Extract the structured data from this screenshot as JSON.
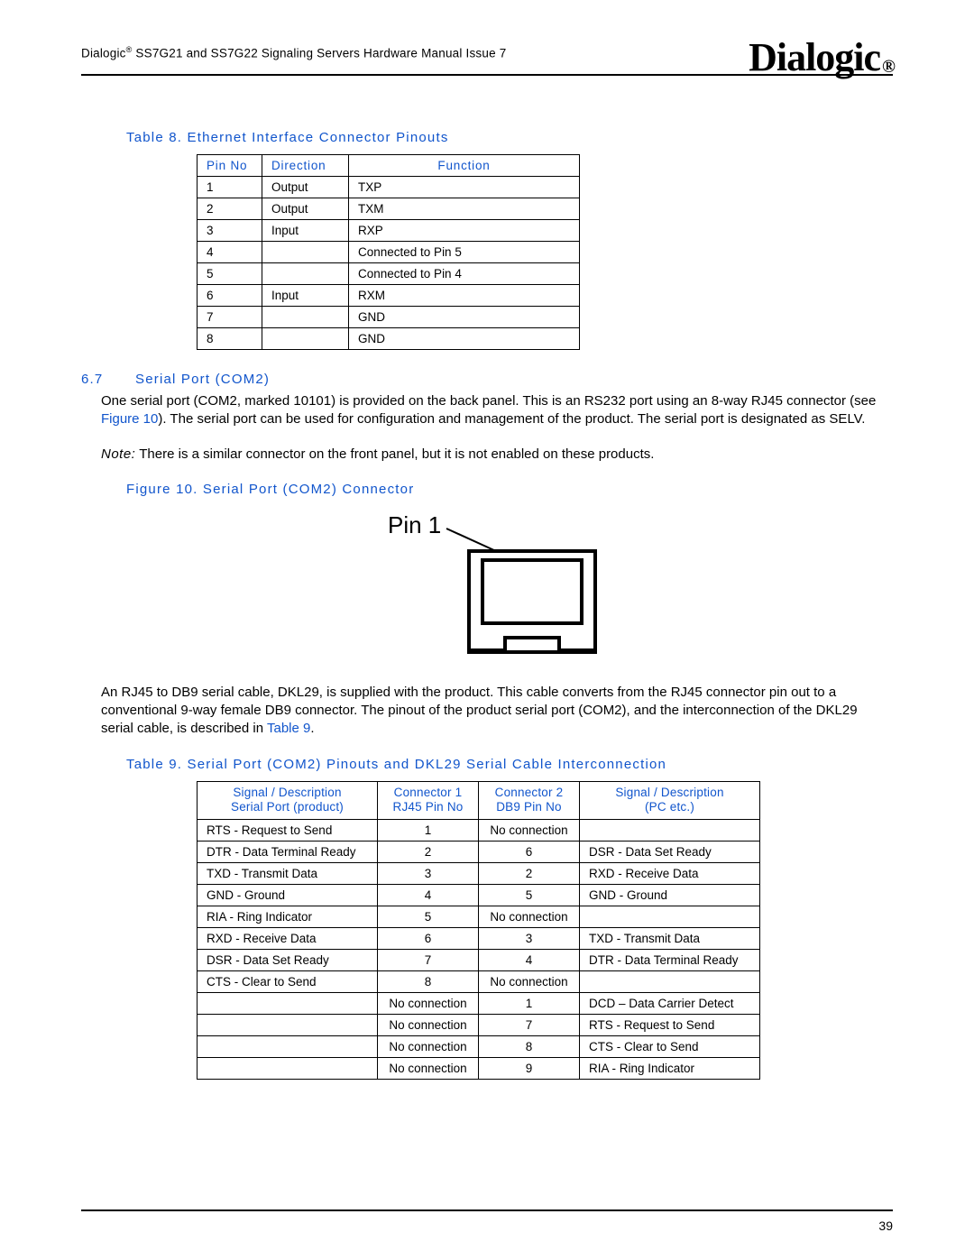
{
  "header": {
    "doc_title_left": "Dialogic",
    "doc_title_rest": " SS7G21 and SS7G22 Signaling Servers Hardware Manual  Issue 7",
    "logo_text": "Dialogic",
    "logo_reg": "®"
  },
  "table8": {
    "caption": "Table 8.  Ethernet Interface Connector Pinouts",
    "headers": {
      "pin": "Pin No",
      "dir": "Direction",
      "fn": "Function"
    },
    "rows": [
      {
        "pin": "1",
        "dir": "Output",
        "fn": "TXP"
      },
      {
        "pin": "2",
        "dir": "Output",
        "fn": "TXM"
      },
      {
        "pin": "3",
        "dir": "Input",
        "fn": "RXP"
      },
      {
        "pin": "4",
        "dir": "",
        "fn": "Connected to Pin 5"
      },
      {
        "pin": "5",
        "dir": "",
        "fn": "Connected to Pin 4"
      },
      {
        "pin": "6",
        "dir": "Input",
        "fn": "RXM"
      },
      {
        "pin": "7",
        "dir": "",
        "fn": "GND"
      },
      {
        "pin": "8",
        "dir": "",
        "fn": "GND"
      }
    ]
  },
  "section67": {
    "num": "6.7",
    "title": "Serial Port (COM2)",
    "para1_a": "One serial port (COM2, marked 10101) is provided on the back panel. This is an RS232 port using an 8-way RJ45 connector (see ",
    "para1_link": "Figure 10",
    "para1_b": "). The serial port can be used for configuration and management of the product. The serial port is designated as SELV.",
    "note_label": "Note:",
    "note_text": " There is a similar connector on the front panel, but it is not enabled on these products."
  },
  "figure10": {
    "caption": "Figure 10. Serial Port (COM2) Connector",
    "pin1_label": "Pin 1"
  },
  "para2": {
    "text_a": "An RJ45 to DB9 serial cable, DKL29, is supplied with the product. This cable converts from the RJ45 connector pin out to a conventional 9-way female DB9 connector. The pinout of the product serial port (COM2), and the interconnection of the DKL29 serial cable, is described in ",
    "link": "Table 9",
    "text_b": "."
  },
  "table9": {
    "caption": "Table 9.  Serial Port (COM2) Pinouts and DKL29 Serial Cable Interconnection",
    "headers": {
      "h1a": "Signal / Description",
      "h1b": "Serial Port (product)",
      "h2a": "Connector 1",
      "h2b": "RJ45 Pin No",
      "h3a": "Connector 2",
      "h3b": "DB9 Pin No",
      "h4a": "Signal / Description",
      "h4b": "(PC etc.)"
    },
    "rows": [
      {
        "c1": "RTS - Request to Send",
        "c2": "1",
        "c3": "No connection",
        "c4": ""
      },
      {
        "c1": "DTR - Data Terminal Ready",
        "c2": "2",
        "c3": "6",
        "c4": "DSR - Data Set Ready"
      },
      {
        "c1": "TXD - Transmit Data",
        "c2": "3",
        "c3": "2",
        "c4": "RXD - Receive Data"
      },
      {
        "c1": "GND - Ground",
        "c2": "4",
        "c3": "5",
        "c4": "GND - Ground"
      },
      {
        "c1": "RIA - Ring Indicator",
        "c2": "5",
        "c3": "No connection",
        "c4": ""
      },
      {
        "c1": "RXD - Receive Data",
        "c2": "6",
        "c3": "3",
        "c4": "TXD - Transmit Data"
      },
      {
        "c1": "DSR - Data Set Ready",
        "c2": "7",
        "c3": "4",
        "c4": "DTR - Data Terminal Ready"
      },
      {
        "c1": "CTS - Clear to Send",
        "c2": "8",
        "c3": "No connection",
        "c4": ""
      },
      {
        "c1": "",
        "c2": "No connection",
        "c3": "1",
        "c4": "DCD – Data Carrier Detect"
      },
      {
        "c1": "",
        "c2": "No connection",
        "c3": "7",
        "c4": "RTS - Request to Send"
      },
      {
        "c1": "",
        "c2": "No connection",
        "c3": "8",
        "c4": "CTS - Clear to Send"
      },
      {
        "c1": "",
        "c2": "No connection",
        "c3": "9",
        "c4": "RIA - Ring Indicator"
      }
    ]
  },
  "page_number": "39"
}
